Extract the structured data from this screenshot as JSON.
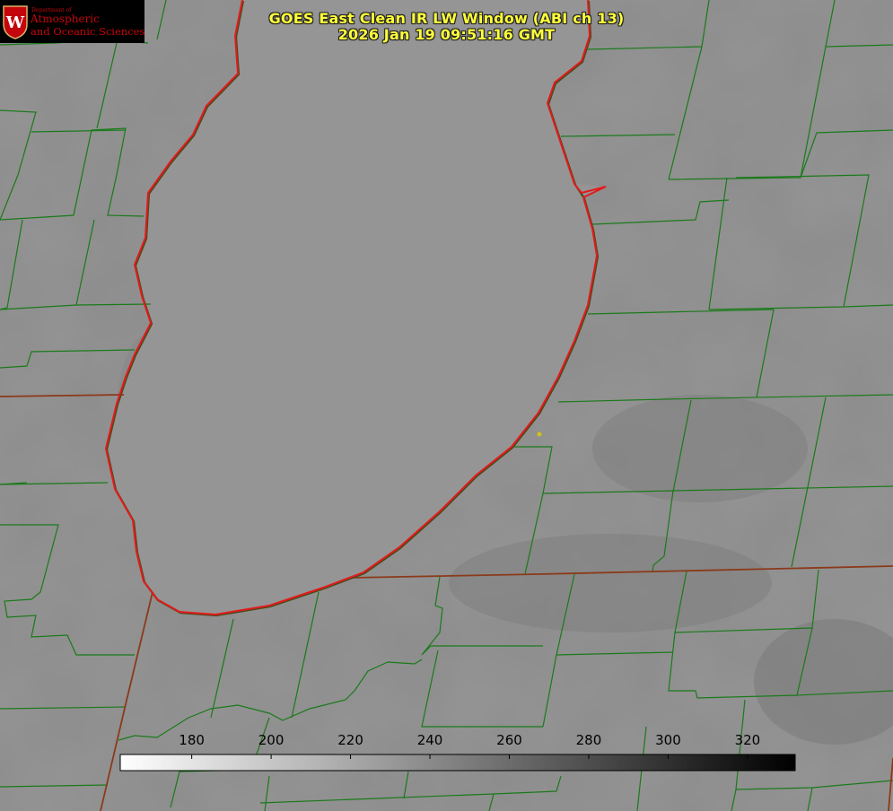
{
  "title": {
    "line1": "GOES East Clean IR LW Window (ABI ch 13)",
    "line2": "2026 Jan 19 09:51:16 GMT"
  },
  "logo": {
    "dept": "Department of",
    "line1": "Atmospheric",
    "line2": "and Oceanic Sciences",
    "crest_letter": "W"
  },
  "colorbar": {
    "ticks": [
      "180",
      "200",
      "220",
      "240",
      "260",
      "280",
      "300",
      "320"
    ],
    "tick_values": [
      180,
      200,
      220,
      240,
      260,
      280,
      300,
      320
    ],
    "range": [
      162,
      332
    ]
  },
  "colors": {
    "lake_outline": "#e31a1c",
    "county_lines": "#1a7a1a",
    "state_lines": "#8b3a1a",
    "title_text": "#ffff3a",
    "marker": "#d4c01a"
  }
}
